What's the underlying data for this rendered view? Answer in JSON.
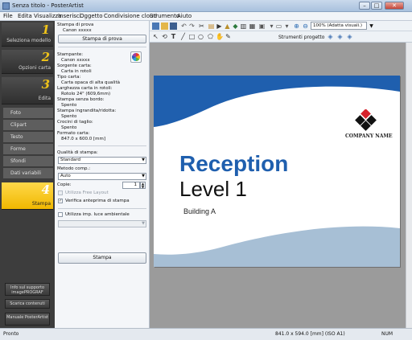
{
  "window": {
    "title": "Senza titolo - PosterArtist"
  },
  "menu": [
    "File",
    "Edita",
    "Visualizza",
    "Inserisci",
    "Oggetto",
    "Condivisione cloud",
    "Strumento",
    "Aiuto"
  ],
  "nav": {
    "steps": [
      {
        "num": "1",
        "label": "Seleziona modello"
      },
      {
        "num": "2",
        "label": "Opzioni carta"
      },
      {
        "num": "3",
        "label": "Edita"
      },
      {
        "num": "4",
        "label": "Stampa"
      }
    ],
    "edit_tabs": [
      "Foto",
      "Clipart",
      "Testo",
      "Forme",
      "Sfondi",
      "Dati variabili"
    ],
    "bottom": [
      {
        "label": "Info sul supporto imagePROGRAF"
      },
      {
        "label": "Scarica contenuti"
      },
      {
        "label": "Manuale PosterArtist"
      }
    ]
  },
  "settings": {
    "test_print_title": "Stampa di prova",
    "test_print_printer": "Canon xxxxx",
    "test_print_button": "Stampa di prova",
    "printer_label": "Stampante:",
    "printer_value": "Canon xxxxx",
    "paper_source_label": "Sorgente carta:",
    "paper_source_value": "Carta in rotoli",
    "paper_type_label": "Tipo carta:",
    "paper_type_value": "Carta opaca di alta qualità",
    "roll_width_label": "Larghezza carta in rotoli:",
    "roll_width_value": "Rotolo 24\" (609,6mm)",
    "borderless_label": "Stampa senza bordo:",
    "borderless_value": "Spento",
    "enlarge_label": "Stampa ingrandita/ridotta:",
    "enlarge_value": "Spento",
    "crop_label": "Crocini di taglio:",
    "crop_value": "Spento",
    "format_label": "Formato carta:",
    "format_value": "847.0 x 600.0 [mm]",
    "quality_label": "Qualità di stampa:",
    "quality_value": "Standard",
    "color_method_label": "Metodo comp.:",
    "color_method_value": "Auto",
    "copies_label": "Copie:",
    "copies_value": "1",
    "free_layout_label": "Utilizza Free Layout",
    "verify_label": "Verifica anteprima di stampa",
    "verify_checked": "✓",
    "ambient_label": "Utilizza imp. luce ambientale",
    "print_button": "Stampa"
  },
  "toolbar": {
    "zoom_value": "100% (Adatta visuali.)",
    "project_tools": "Strumenti progetto"
  },
  "poster": {
    "logo_text": "COMPANY NAME",
    "title": "Reception",
    "subtitle": "Level 1",
    "building": "Building A"
  },
  "status": {
    "ready": "Pronto",
    "size": "841.0 x 594.0 [mm] (ISO A1)",
    "num": "NUM"
  },
  "colors": {
    "nav_yellow": "#f0c419",
    "poster_blue": "#1f5fae",
    "poster_light_blue": "#a7bfd5",
    "logo_red": "#d6212b"
  }
}
